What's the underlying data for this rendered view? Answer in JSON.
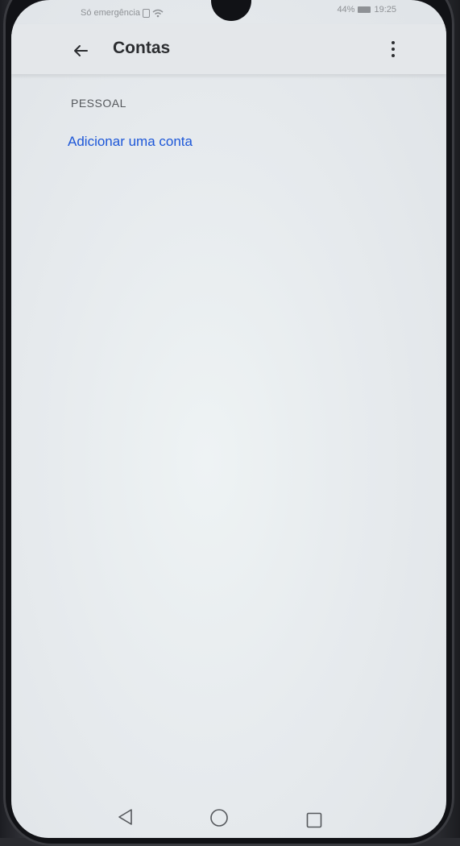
{
  "status_bar": {
    "carrier_text": "Só emergência",
    "battery_percent": "44%",
    "time": "19:25",
    "icons": [
      "sim-icon",
      "wifi-icon",
      "battery-icon"
    ]
  },
  "app_bar": {
    "title": "Contas",
    "back_icon": "arrow-left-icon",
    "more_icon": "more-vert-icon"
  },
  "sections": [
    {
      "header": "PESSOAL",
      "action": "Adicionar uma conta"
    }
  ],
  "nav_bar": {
    "icons": [
      "nav-back-icon",
      "nav-home-icon",
      "nav-recent-icon"
    ]
  },
  "colors": {
    "accent": "#1d57d8",
    "text_primary": "#2b2d30",
    "text_secondary": "#55585c"
  }
}
